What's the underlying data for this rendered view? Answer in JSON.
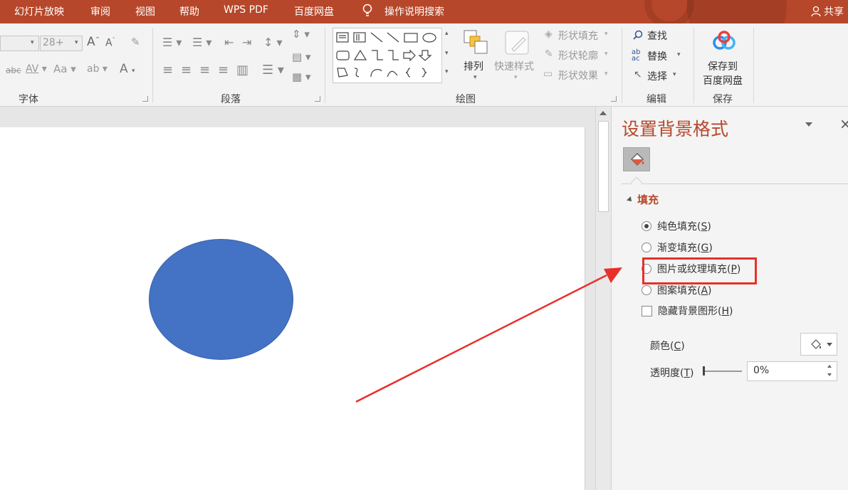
{
  "tabs": [
    "幻灯片放映",
    "审阅",
    "视图",
    "帮助",
    "WPS PDF",
    "百度网盘",
    "操作说明搜索"
  ],
  "share_label": "共享",
  "ribbon": {
    "font": {
      "label": "字体",
      "size_value": "28+"
    },
    "paragraph": {
      "label": "段落"
    },
    "drawing": {
      "label": "绘图",
      "arrange": "排列",
      "quick_styles": "快速样式",
      "shape_fill": "形状填充",
      "shape_outline": "形状轮廓",
      "shape_effects": "形状效果"
    },
    "editing": {
      "label": "编辑",
      "find": "查找",
      "replace": "替换",
      "select": "选择"
    },
    "save": {
      "label": "保存",
      "save_to_line1": "保存到",
      "save_to_line2": "百度网盘"
    }
  },
  "pane": {
    "title": "设置背景格式",
    "section": "填充",
    "options": [
      {
        "text": "纯色填充(",
        "key": "S",
        "selected": true
      },
      {
        "text": "渐变填充(",
        "key": "G",
        "selected": false
      },
      {
        "text": "图片或纹理填充(",
        "key": "P",
        "selected": false
      },
      {
        "text": "图案填充(",
        "key": "A",
        "selected": false
      }
    ],
    "hide_bg": {
      "text": "隐藏背景图形(",
      "key": "H",
      "checked": false
    },
    "color_label": {
      "text": "颜色(",
      "key": "C"
    },
    "transparency_label": {
      "text": "透明度(",
      "key": "T"
    },
    "transparency_value": "0%"
  },
  "colors": {
    "accent": "#b7472a",
    "ellipse": "#4472c4",
    "highlight": "#e8302a"
  }
}
